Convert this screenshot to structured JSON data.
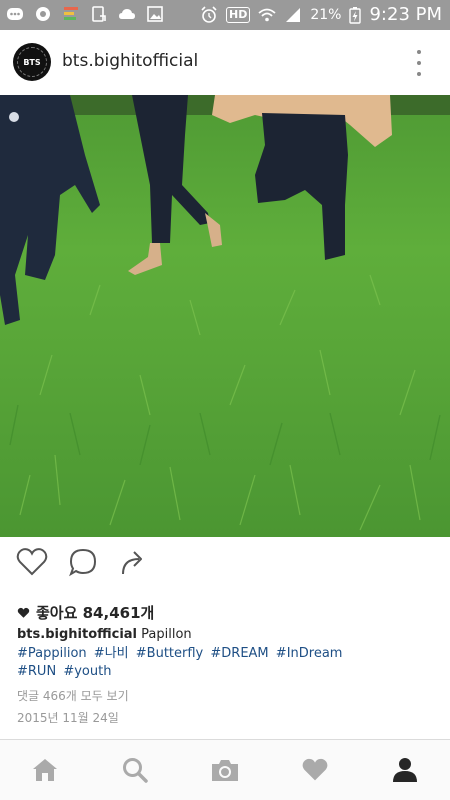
{
  "status_bar": {
    "battery_percent": "21%",
    "time": "9:23 PM",
    "hd_label": "HD",
    "icons": [
      "messenger-icon",
      "settings-icon",
      "stocks-icon",
      "screen-icon",
      "cloud-icon",
      "image-icon",
      "alarm-icon",
      "hd-icon",
      "wifi-icon",
      "signal-icon",
      "battery-icon"
    ]
  },
  "post": {
    "username": "bts.bighitofficial",
    "avatar_text": "BTS",
    "likes_label": "좋아요 84,461개",
    "caption_user": "bts.bighitofficial",
    "caption_text": "Papillon",
    "hashtags": [
      "#Pappilion",
      "#나비",
      "#Butterfly",
      "#DREAM",
      "#InDream",
      "#RUN",
      "#youth"
    ],
    "view_comments": "댓글 466개 모두 보기",
    "date": "2015년 11월 24일"
  },
  "actions": [
    "like-icon",
    "comment-icon",
    "share-icon"
  ],
  "bottom_nav": [
    "home-icon",
    "search-icon",
    "camera-icon",
    "activity-icon",
    "profile-icon"
  ],
  "colors": {
    "status_bar": "#9a9a9a",
    "hashtag": "#1e4f85",
    "muted": "#999999",
    "grass": "#5fae3b"
  }
}
